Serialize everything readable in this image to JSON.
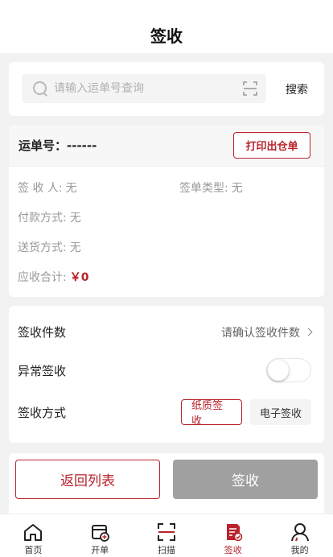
{
  "header": {
    "title": "签收"
  },
  "search": {
    "placeholder": "请输入运单号查询",
    "value": "",
    "button_label": "搜索"
  },
  "waybill": {
    "number_label": "运单号：------",
    "print_label": "打印出仓单",
    "fields": {
      "receiver_label": "签 收 人:",
      "receiver_value": "无",
      "sign_type_label": "签单类型:",
      "sign_type_value": "无",
      "payment_label": "付款方式:",
      "payment_value": "无",
      "delivery_label": "送货方式:",
      "delivery_value": "无",
      "total_label": "应收合计:",
      "total_value": "￥0"
    }
  },
  "sign": {
    "count_label": "签收件数",
    "count_action": "请确认签收件数",
    "abnormal_label": "异常签收",
    "abnormal_on": false,
    "method_label": "签收方式",
    "methods": [
      {
        "label": "纸质签收",
        "selected": true
      },
      {
        "label": "电子签收",
        "selected": false
      }
    ]
  },
  "actions": {
    "back_label": "返回列表",
    "sign_label": "签收"
  },
  "tabbar": [
    {
      "label": "首页",
      "icon": "home-icon",
      "active": false
    },
    {
      "label": "开单",
      "icon": "order-icon",
      "active": false
    },
    {
      "label": "扫描",
      "icon": "scan-icon",
      "active": false
    },
    {
      "label": "签收",
      "icon": "sign-icon",
      "active": true
    },
    {
      "label": "我的",
      "icon": "user-icon",
      "active": false
    }
  ],
  "colors": {
    "accent": "#b8232b",
    "disabled": "#a0a0a0"
  }
}
